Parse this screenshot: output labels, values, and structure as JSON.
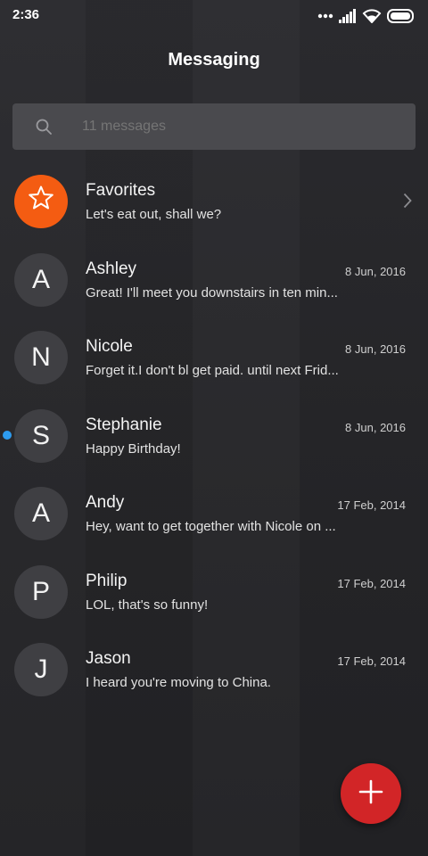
{
  "status_bar": {
    "time": "2:36",
    "icons": [
      "more-dots-icon",
      "signal-icon",
      "wifi-icon",
      "battery-icon"
    ]
  },
  "header": {
    "title": "Messaging"
  },
  "search": {
    "placeholder": "11 messages",
    "icon": "search-icon"
  },
  "conversations": [
    {
      "initial": "",
      "name": "Favorites",
      "snippet": "Let's eat out, shall we?",
      "date": "",
      "type": "favorites",
      "icon": "star-icon"
    },
    {
      "initial": "A",
      "name": "Ashley",
      "snippet": "Great! I'll meet you downstairs in ten min...",
      "date": "8 Jun, 2016",
      "unread": false
    },
    {
      "initial": "N",
      "name": "Nicole",
      "snippet": "Forget it.I don't bl get paid. until next Frid...",
      "date": "8 Jun, 2016",
      "unread": false
    },
    {
      "initial": "S",
      "name": "Stephanie",
      "snippet": "Happy Birthday!",
      "date": "8 Jun, 2016",
      "unread": true
    },
    {
      "initial": "A",
      "name": "Andy",
      "snippet": "Hey, want to get together with Nicole on ...",
      "date": "17 Feb, 2014",
      "unread": false
    },
    {
      "initial": "P",
      "name": "Philip",
      "snippet": "LOL, that's so funny!",
      "date": "17 Feb, 2014",
      "unread": false
    },
    {
      "initial": "J",
      "name": "Jason",
      "snippet": "I heard you're moving to China.",
      "date": "17 Feb, 2014",
      "unread": false
    }
  ],
  "fab": {
    "icon": "plus-icon"
  },
  "colors": {
    "favorites_avatar": "#f45c12",
    "fab": "#d22527",
    "unread_dot": "#2d9cf0",
    "search_bg": "#4a4a4e"
  }
}
